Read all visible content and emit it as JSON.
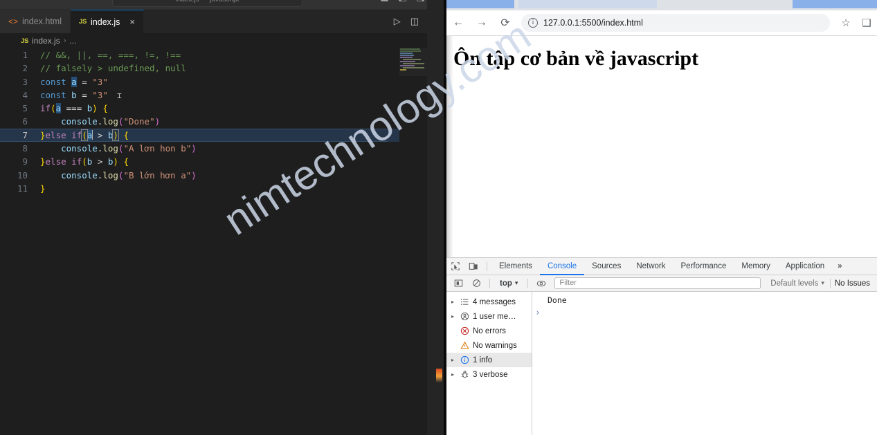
{
  "vscode": {
    "titlebar_search": "index.js — javascript",
    "titlebar_icons": [
      "layout-panel-icon",
      "layout-sidebar-icon",
      "layout-grid-icon",
      "ellipsis-icon"
    ],
    "tabs": [
      {
        "label": "index.html",
        "icon": "html-file-icon",
        "active": false,
        "closable": false
      },
      {
        "label": "index.js",
        "icon": "js-file-icon",
        "active": true,
        "closable": true,
        "close_label": "×"
      }
    ],
    "tab_actions": [
      {
        "name": "run-button",
        "glyph": "▷"
      },
      {
        "name": "split-editor-button",
        "glyph": "◫"
      },
      {
        "name": "more-actions-button",
        "glyph": "⋯"
      }
    ],
    "breadcrumb": {
      "icon": "js-file-icon",
      "file": "index.js",
      "separator": "›",
      "tail": "..."
    },
    "code_lines": [
      {
        "n": "1",
        "tokens": [
          {
            "t": "// && , ||, ==, ===, !=, !==",
            "c": "t-com",
            "raw": "// &&, ||, ==, ===, !=, !=="
          }
        ]
      },
      {
        "n": "2",
        "tokens": [
          {
            "t": "// falsely > undefined, null",
            "c": "t-com"
          }
        ]
      },
      {
        "n": "3",
        "tokens": [
          {
            "t": "const ",
            "c": "t-kw"
          },
          {
            "t": "a",
            "c": "t-var sel"
          },
          {
            "t": " = ",
            "c": "t-op"
          },
          {
            "t": "\"3\"",
            "c": "t-str"
          }
        ]
      },
      {
        "n": "4",
        "tokens": [
          {
            "t": "const ",
            "c": "t-kw"
          },
          {
            "t": "b",
            "c": "t-var"
          },
          {
            "t": " = ",
            "c": "t-op"
          },
          {
            "t": "\"3\"",
            "c": "t-str"
          },
          {
            "t": "  ⌶",
            "c": "mousecur"
          }
        ]
      },
      {
        "n": "5",
        "tokens": [
          {
            "t": "if",
            "c": "t-ctl"
          },
          {
            "t": "(",
            "c": "t-br1"
          },
          {
            "t": "a",
            "c": "t-var sel"
          },
          {
            "t": " === ",
            "c": "t-op"
          },
          {
            "t": "b",
            "c": "t-var"
          },
          {
            "t": ")",
            "c": "t-br1"
          },
          {
            "t": " ",
            "c": "t-op"
          },
          {
            "t": "{",
            "c": "t-br1"
          }
        ]
      },
      {
        "n": "6",
        "tokens": [
          {
            "t": "    ",
            "c": "t-op"
          },
          {
            "t": "console",
            "c": "t-obj"
          },
          {
            "t": ".",
            "c": "t-pun"
          },
          {
            "t": "log",
            "c": "t-fn"
          },
          {
            "t": "(",
            "c": "t-br2"
          },
          {
            "t": "\"Done\"",
            "c": "t-str"
          },
          {
            "t": ")",
            "c": "t-br2"
          }
        ]
      },
      {
        "n": "7",
        "active": true,
        "tokens": [
          {
            "t": "}",
            "c": "t-br1"
          },
          {
            "t": "else ",
            "c": "t-ctl"
          },
          {
            "t": "if",
            "c": "t-ctl"
          },
          {
            "t": "(",
            "c": "t-br1 brmatch"
          },
          {
            "t": "a",
            "c": "t-var sel"
          },
          {
            "t": "|",
            "c": "caretmark"
          },
          {
            "t": " > ",
            "c": "t-op"
          },
          {
            "t": "b",
            "c": "t-var"
          },
          {
            "t": ")",
            "c": "t-br1 brmatch"
          },
          {
            "t": " ",
            "c": "t-op"
          },
          {
            "t": "{",
            "c": "t-br1"
          }
        ]
      },
      {
        "n": "8",
        "tokens": [
          {
            "t": "    ",
            "c": "t-op"
          },
          {
            "t": "console",
            "c": "t-obj"
          },
          {
            "t": ".",
            "c": "t-pun"
          },
          {
            "t": "log",
            "c": "t-fn"
          },
          {
            "t": "(",
            "c": "t-br2"
          },
          {
            "t": "\"A lơn hon b\"",
            "c": "t-str"
          },
          {
            "t": ")",
            "c": "t-br2"
          }
        ]
      },
      {
        "n": "9",
        "tokens": [
          {
            "t": "}",
            "c": "t-br1"
          },
          {
            "t": "else ",
            "c": "t-ctl"
          },
          {
            "t": "if",
            "c": "t-ctl"
          },
          {
            "t": "(",
            "c": "t-br1"
          },
          {
            "t": "b",
            "c": "t-var"
          },
          {
            "t": " > ",
            "c": "t-op"
          },
          {
            "t": "b",
            "c": "t-var"
          },
          {
            "t": ")",
            "c": "t-br1"
          },
          {
            "t": " ",
            "c": "t-op"
          },
          {
            "t": "{",
            "c": "t-br1"
          }
        ]
      },
      {
        "n": "10",
        "tokens": [
          {
            "t": "    ",
            "c": "t-op"
          },
          {
            "t": "console",
            "c": "t-obj"
          },
          {
            "t": ".",
            "c": "t-pun"
          },
          {
            "t": "log",
            "c": "t-fn"
          },
          {
            "t": "(",
            "c": "t-br2"
          },
          {
            "t": "\"B lớn hơn a\"",
            "c": "t-str"
          },
          {
            "t": ")",
            "c": "t-br2"
          }
        ]
      },
      {
        "n": "11",
        "tokens": [
          {
            "t": "}",
            "c": "t-br1"
          }
        ]
      }
    ]
  },
  "chrome": {
    "nav": {
      "back": "←",
      "forward": "→",
      "reload": "⟳",
      "info_glyph": "i",
      "url": "127.0.0.1:5500/index.html",
      "star": "☆",
      "extensions": "❑"
    },
    "page": {
      "heading": "Ôn tập cơ bản về javascript"
    }
  },
  "watermark": {
    "text": "nimtechnology.com"
  },
  "devtools": {
    "left_icons": [
      {
        "name": "inspect-element-icon",
        "glyph": "⌖"
      },
      {
        "name": "device-toolbar-icon",
        "glyph": "□"
      }
    ],
    "tabs": [
      {
        "label": "Elements",
        "active": false
      },
      {
        "label": "Console",
        "active": true
      },
      {
        "label": "Sources",
        "active": false
      },
      {
        "label": "Network",
        "active": false
      },
      {
        "label": "Performance",
        "active": false
      },
      {
        "label": "Memory",
        "active": false
      },
      {
        "label": "Application",
        "active": false
      }
    ],
    "more_tabs": "»",
    "console_toolbar": {
      "sidebar_toggle": "◧",
      "clear_console": "⊘",
      "context": "top",
      "context_caret": "▾",
      "eye_icon": "◉",
      "filter_placeholder": "Filter",
      "filter_value": "",
      "levels": "Default levels",
      "levels_caret": "▾",
      "issues": "No Issues"
    },
    "sidebar": [
      {
        "label": "4 messages",
        "icon": "list-icon",
        "arrow": "▸",
        "selected": false
      },
      {
        "label": "1 user me…",
        "icon": "user-icon",
        "arrow": "▸",
        "selected": false
      },
      {
        "label": "No errors",
        "icon": "error-icon",
        "arrow": "",
        "selected": false
      },
      {
        "label": "No warnings",
        "icon": "warning-icon",
        "arrow": "",
        "selected": false
      },
      {
        "label": "1 info",
        "icon": "info-icon",
        "arrow": "▸",
        "selected": true
      },
      {
        "label": "3 verbose",
        "icon": "bug-icon",
        "arrow": "▸",
        "selected": false
      }
    ],
    "messages": [
      {
        "text": "Done"
      }
    ],
    "prompt_glyph": "›"
  },
  "colors": {
    "vscode_bg": "#1e1e1e",
    "vscode_tabbar": "#252526",
    "accent_blue": "#0078d4",
    "devtools_accent": "#1a73e8",
    "watermark": "#ccd7e8"
  }
}
